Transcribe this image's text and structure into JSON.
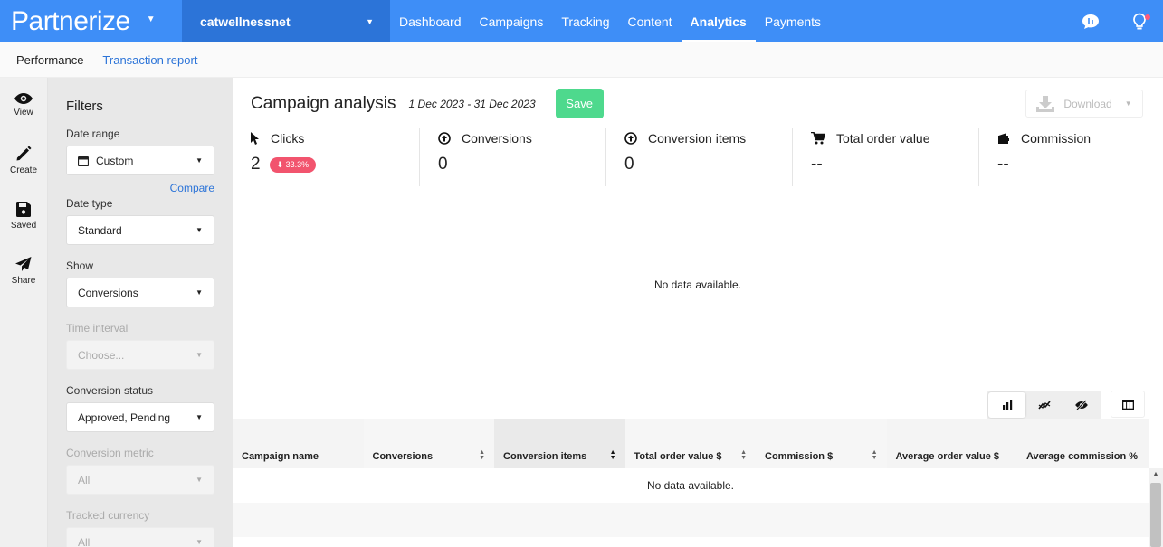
{
  "nav": {
    "logo": "Partnerize",
    "account": "catwellnessnet",
    "links": [
      "Dashboard",
      "Campaigns",
      "Tracking",
      "Content",
      "Analytics",
      "Payments"
    ],
    "active_link": "Analytics"
  },
  "subnav": {
    "tabs": [
      "Performance",
      "Transaction report"
    ]
  },
  "rail": {
    "items": [
      {
        "label": "View",
        "icon": "eye-icon"
      },
      {
        "label": "Create",
        "icon": "pencil-icon"
      },
      {
        "label": "Saved",
        "icon": "floppy-icon"
      },
      {
        "label": "Share",
        "icon": "paper-plane-icon"
      }
    ]
  },
  "filters": {
    "title": "Filters",
    "date_range_label": "Date range",
    "date_range_value": "Custom",
    "compare": "Compare",
    "date_type_label": "Date type",
    "date_type_value": "Standard",
    "show_label": "Show",
    "show_value": "Conversions",
    "time_interval_label": "Time interval",
    "time_interval_value": "Choose...",
    "conversion_status_label": "Conversion status",
    "conversion_status_value": "Approved, Pending",
    "conversion_metric_label": "Conversion metric",
    "conversion_metric_value": "All",
    "tracked_currency_label": "Tracked currency",
    "tracked_currency_value": "All"
  },
  "main": {
    "title": "Campaign analysis",
    "date_range": "1 Dec 2023 - 31 Dec 2023",
    "save": "Save",
    "download": "Download",
    "metrics": [
      {
        "label": "Clicks",
        "value": "2",
        "badge": "⬇ 33.3%"
      },
      {
        "label": "Conversions",
        "value": "0"
      },
      {
        "label": "Conversion items",
        "value": "0"
      },
      {
        "label": "Total order value",
        "value": "--"
      },
      {
        "label": "Commission",
        "value": "--"
      }
    ],
    "chart_nodata": "No data available.",
    "table": {
      "columns": [
        "Campaign name",
        "Conversions",
        "Conversion items",
        "Total order value $",
        "Commission $",
        "Average order value $",
        "Average commission %"
      ],
      "nodata": "No data available."
    }
  }
}
